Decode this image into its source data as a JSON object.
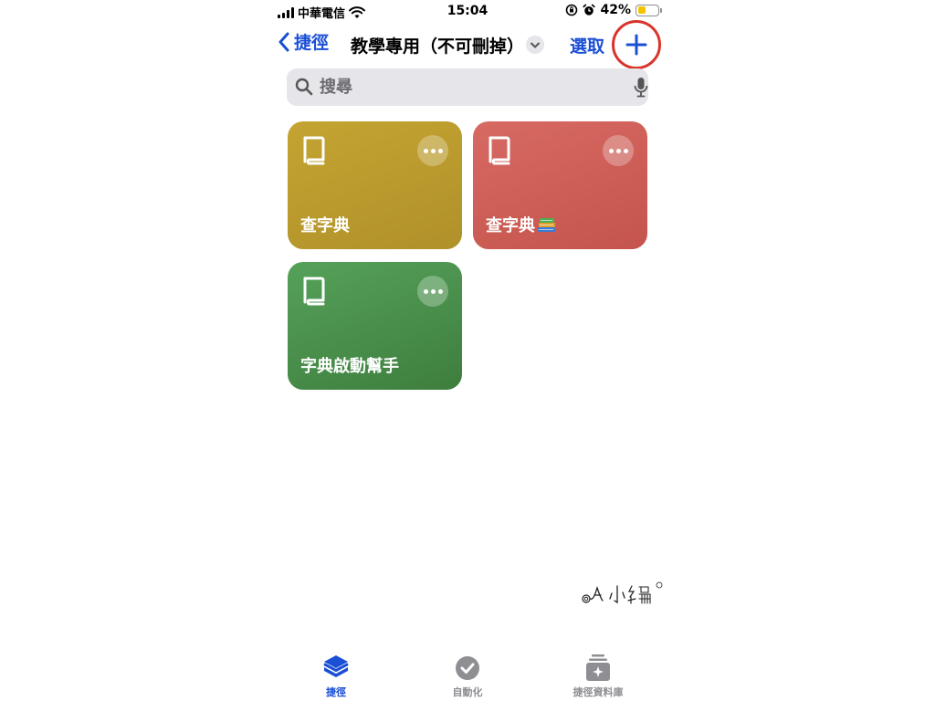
{
  "status_bar": {
    "carrier": "中華電信",
    "time": "15:04",
    "battery_percent": "42%",
    "battery_level": 0.42,
    "battery_color": "#f5c400"
  },
  "nav": {
    "back_label": "捷徑",
    "title": "教學專用（不可刪掉）",
    "select_label": "選取",
    "add_icon": "plus-icon",
    "accent_color": "#1a4fd6",
    "highlight_ring_color": "#d9342b"
  },
  "search": {
    "placeholder": "搜尋",
    "value": ""
  },
  "shortcuts": [
    {
      "label": "查字典",
      "color": "#b89a2c",
      "icon": "book-icon"
    },
    {
      "label": "查字典",
      "emoji": "books-emoji",
      "color": "#cd5d55",
      "icon": "book-icon"
    },
    {
      "label": "字典啟動幫手",
      "color": "#4a8f4b",
      "icon": "book-icon"
    }
  ],
  "watermark": {
    "logo": "A小編 signature logo"
  },
  "tab_bar": {
    "tabs": [
      {
        "label": "捷徑",
        "icon": "layers-icon",
        "active": true
      },
      {
        "label": "自動化",
        "icon": "clock-check-icon",
        "active": false
      },
      {
        "label": "捷徑資料庫",
        "icon": "gallery-icon",
        "active": false
      }
    ]
  }
}
